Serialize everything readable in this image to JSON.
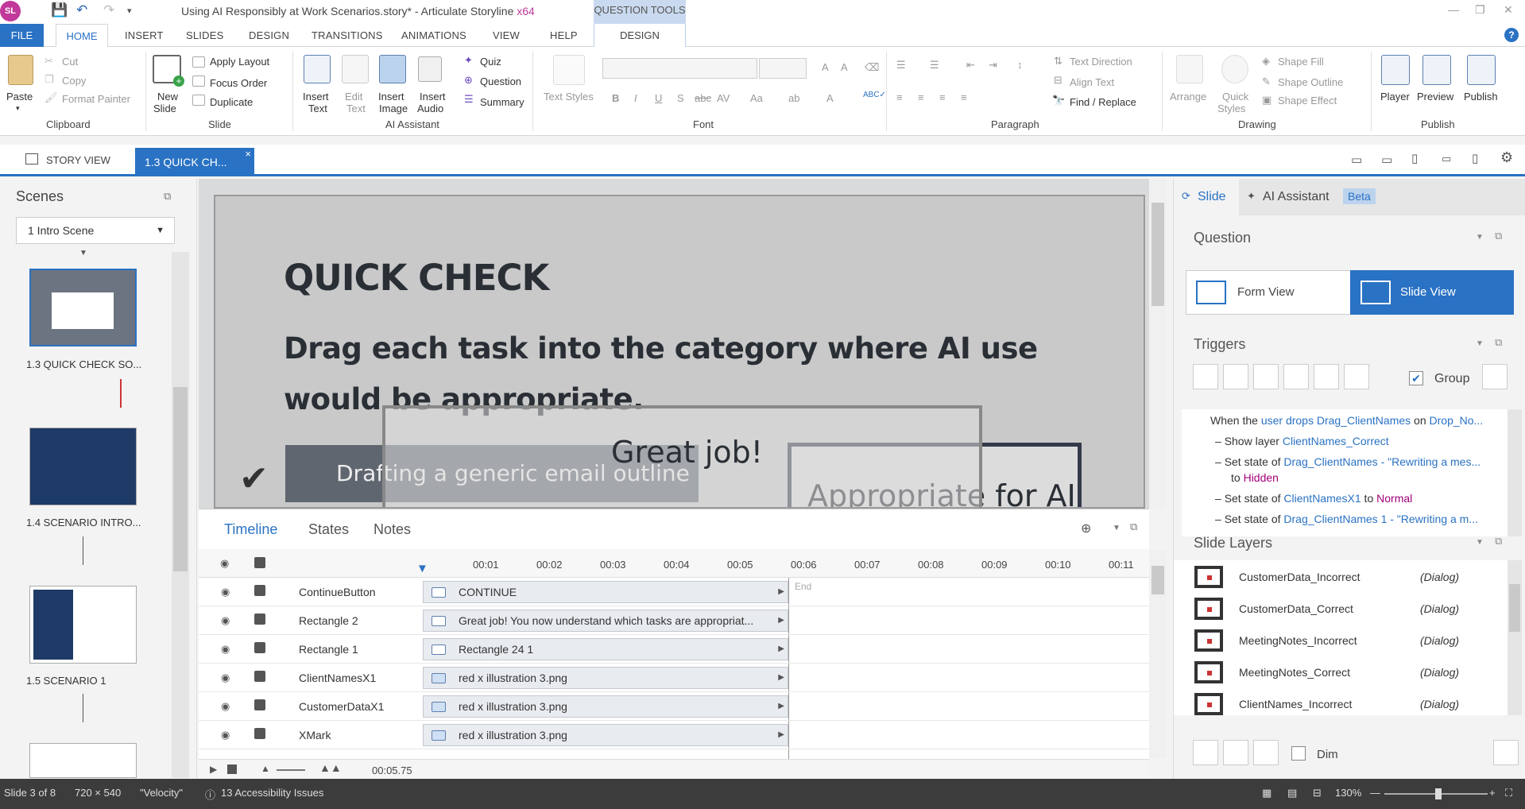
{
  "titlebar": {
    "logo": "SL",
    "doc_title": "Using AI Responsibly at Work Scenarios.story* - Articulate Storyline",
    "arch": "x64",
    "question_tools": "QUESTION TOOLS"
  },
  "tabs": [
    "FILE",
    "HOME",
    "INSERT",
    "SLIDES",
    "DESIGN",
    "TRANSITIONS",
    "ANIMATIONS",
    "VIEW",
    "HELP",
    "DESIGN"
  ],
  "ribbon": {
    "clipboard": {
      "paste": "Paste",
      "cut": "Cut",
      "copy": "Copy",
      "format_painter": "Format Painter",
      "label": "Clipboard"
    },
    "slide": {
      "new_slide": "New",
      "new_slide2": "Slide",
      "apply_layout": "Apply Layout",
      "focus_order": "Focus Order",
      "duplicate": "Duplicate",
      "label": "Slide"
    },
    "ai": {
      "insert_text": "Insert",
      "insert_text2": "Text",
      "edit_text": "Edit",
      "edit_text2": "Text",
      "insert_image": "Insert",
      "insert_image2": "Image",
      "insert_audio": "Insert",
      "insert_audio2": "Audio",
      "quiz": "Quiz",
      "question": "Question",
      "summary": "Summary",
      "label": "AI Assistant"
    },
    "font": {
      "text_styles": "Text Styles",
      "label": "Font"
    },
    "paragraph": {
      "text_direction": "Text Direction",
      "align_text": "Align Text",
      "find_replace": "Find / Replace",
      "label": "Paragraph"
    },
    "drawing": {
      "arrange": "Arrange",
      "quick_styles": "Quick",
      "quick_styles2": "Styles",
      "shape_fill": "Shape Fill",
      "shape_outline": "Shape Outline",
      "shape_effect": "Shape Effect",
      "label": "Drawing"
    },
    "publish": {
      "player": "Player",
      "preview": "Preview",
      "publish": "Publish",
      "label": "Publish"
    }
  },
  "doctabs": {
    "story_view": "STORY VIEW",
    "slide_tab": "1.3 QUICK CH...",
    "close": "×"
  },
  "scenes": {
    "title": "Scenes",
    "selected": "1 Intro Scene",
    "items": [
      {
        "label": "1.3 QUICK CHECK SO..."
      },
      {
        "label": "1.4 SCENARIO INTRO..."
      },
      {
        "label": "1.5 SCENARIO 1"
      }
    ]
  },
  "slide": {
    "title": "QUICK CHECK",
    "instruction": "Drag each task into the category where AI use would be appropriate.",
    "feedback": "Great job!",
    "drag_item": "Drafting a generic email outline",
    "drop_target": "Appropriate for AI",
    "check": "✔"
  },
  "timeline": {
    "tabs": [
      "Timeline",
      "States",
      "Notes"
    ],
    "ticks": [
      "00:01",
      "00:02",
      "00:03",
      "00:04",
      "00:05",
      "00:06",
      "00:07",
      "00:08",
      "00:09",
      "00:10",
      "00:11"
    ],
    "end_label": "End",
    "rows": [
      {
        "name": "ContinueButton",
        "bar": "CONTINUE"
      },
      {
        "name": "Rectangle 2",
        "bar": "Great job! You now understand which tasks are appropriat..."
      },
      {
        "name": "Rectangle 1",
        "bar": "Rectangle 24 1"
      },
      {
        "name": "ClientNamesX1",
        "bar": "red x illustration 3.png"
      },
      {
        "name": "CustomerDataX1",
        "bar": "red x illustration 3.png"
      },
      {
        "name": "XMark",
        "bar": "red x illustration 3.png"
      }
    ],
    "duration": "00:05.75"
  },
  "rpanel": {
    "tab_slide": "Slide",
    "tab_ai": "AI Assistant",
    "beta": "Beta",
    "question": "Question",
    "form_view": "Form View",
    "slide_view": "Slide View",
    "triggers": "Triggers",
    "group": "Group",
    "trigger_lines": [
      {
        "pre": "When the ",
        "a": "user drops",
        "mid": " ",
        "b": "Drag_ClientNames",
        "mid2": " on ",
        "c": "Drop_No..."
      },
      {
        "pre": "Show layer ",
        "a": "ClientNames_Correct"
      },
      {
        "pre": "Set state of ",
        "a": "Drag_ClientNames - \"Rewriting a mes..."
      },
      {
        "pre": "to ",
        "a": "Hidden"
      },
      {
        "pre": "Set state of ",
        "a": "ClientNamesX1",
        "mid": " to ",
        "b": "Normal"
      },
      {
        "pre": "Set state of ",
        "a": "Drag_ClientNames 1 - \"Rewriting a m..."
      }
    ],
    "layers_title": "Slide Layers",
    "layers": [
      {
        "name": "CustomerData_Incorrect",
        "type": "(Dialog)"
      },
      {
        "name": "CustomerData_Correct",
        "type": "(Dialog)"
      },
      {
        "name": "MeetingNotes_Incorrect",
        "type": "(Dialog)"
      },
      {
        "name": "MeetingNotes_Correct",
        "type": "(Dialog)"
      },
      {
        "name": "ClientNames_Incorrect",
        "type": "(Dialog)"
      }
    ],
    "dim": "Dim"
  },
  "status": {
    "slide": "Slide 3 of 8",
    "size": "720 × 540",
    "theme": "\"Velocity\"",
    "issues": "13 Accessibility Issues",
    "zoom": "130%"
  },
  "colors": {
    "accent": "#2a72c3",
    "brand": "#c0399b"
  }
}
